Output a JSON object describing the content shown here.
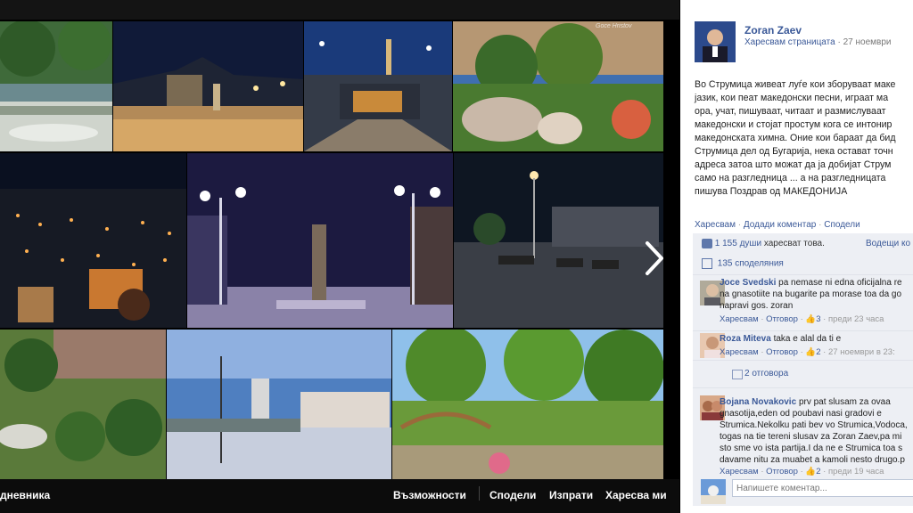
{
  "viewer": {
    "album_name_partial": "дневника",
    "actions": [
      "Възможности",
      "Сподели",
      "Изпрати",
      "Харесва ми"
    ],
    "next_arrow_icon": "chevron-right-icon",
    "photo_watermark": "Goce Hristov"
  },
  "post": {
    "page_name": "Zoran Zaev",
    "subtitle_like": "Харесвам страницата",
    "subtitle_sep": " · ",
    "date": "27 ноември",
    "text_lines": [
      "Во Струмица живеат луѓе кои зборуваат маке",
      "јазик, кои пеат македонски песни, играат ма",
      "ора, учат, пишуваат, читаат и размислуваат",
      "македонски и стојат простум кога се интонир",
      "македонската химна. Оние кои бараат да бид",
      "Струмица дел од Бугарија, нека остават точн",
      "адреса затоа што можат да ја добијат Струм",
      "само на разгледница ... а на разгледницата",
      "пишува Поздрав од МАКЕДОНИЈА"
    ],
    "action_like": "Харесвам",
    "action_comment": "Додади коментар",
    "action_share": "Сподели",
    "likes_count": "1 155 души",
    "likes_suffix": "харесват това.",
    "likes_right": "Водещи ко",
    "shares": "135 споделяния",
    "comment_placeholder": "Напишете коментар...",
    "replies_label": "2 отговора"
  },
  "comments": [
    {
      "author": "Joce Svedski",
      "text": "pa nemase ni edna oficijalna re na gnasotiite na bugarite pa morase toa da go napravi gos. zoran",
      "like": "Харесвам",
      "reply": "Отговор",
      "likes": "3",
      "time": "преди 23 часа"
    },
    {
      "author": "Roza Miteva",
      "text": "taka e alal da ti e",
      "like": "Харесвам",
      "reply": "Отговор",
      "likes": "2",
      "time": "27 ноември в 23:"
    },
    {
      "author": "Bojana Novakovic",
      "text": "prv pat slusam za ovaa gnasotija,eden od poubavi nasi gradovi e Strumica.Nekolku pati bev vo Strumica,Vodoca, togas na tie tereni slusav za Zoran Zaev,pa mi sto sme vo ista partija.I da ne e Strumica toa s davame nitu za muabet a kamoli nesto drugo.p",
      "like": "Харесвам",
      "reply": "Отговор",
      "likes": "2",
      "time": "преди 19 часа"
    }
  ],
  "colors": {
    "link": "#3b5998",
    "comment_bg": "#edeff4",
    "viewer_bg": "#000000"
  }
}
